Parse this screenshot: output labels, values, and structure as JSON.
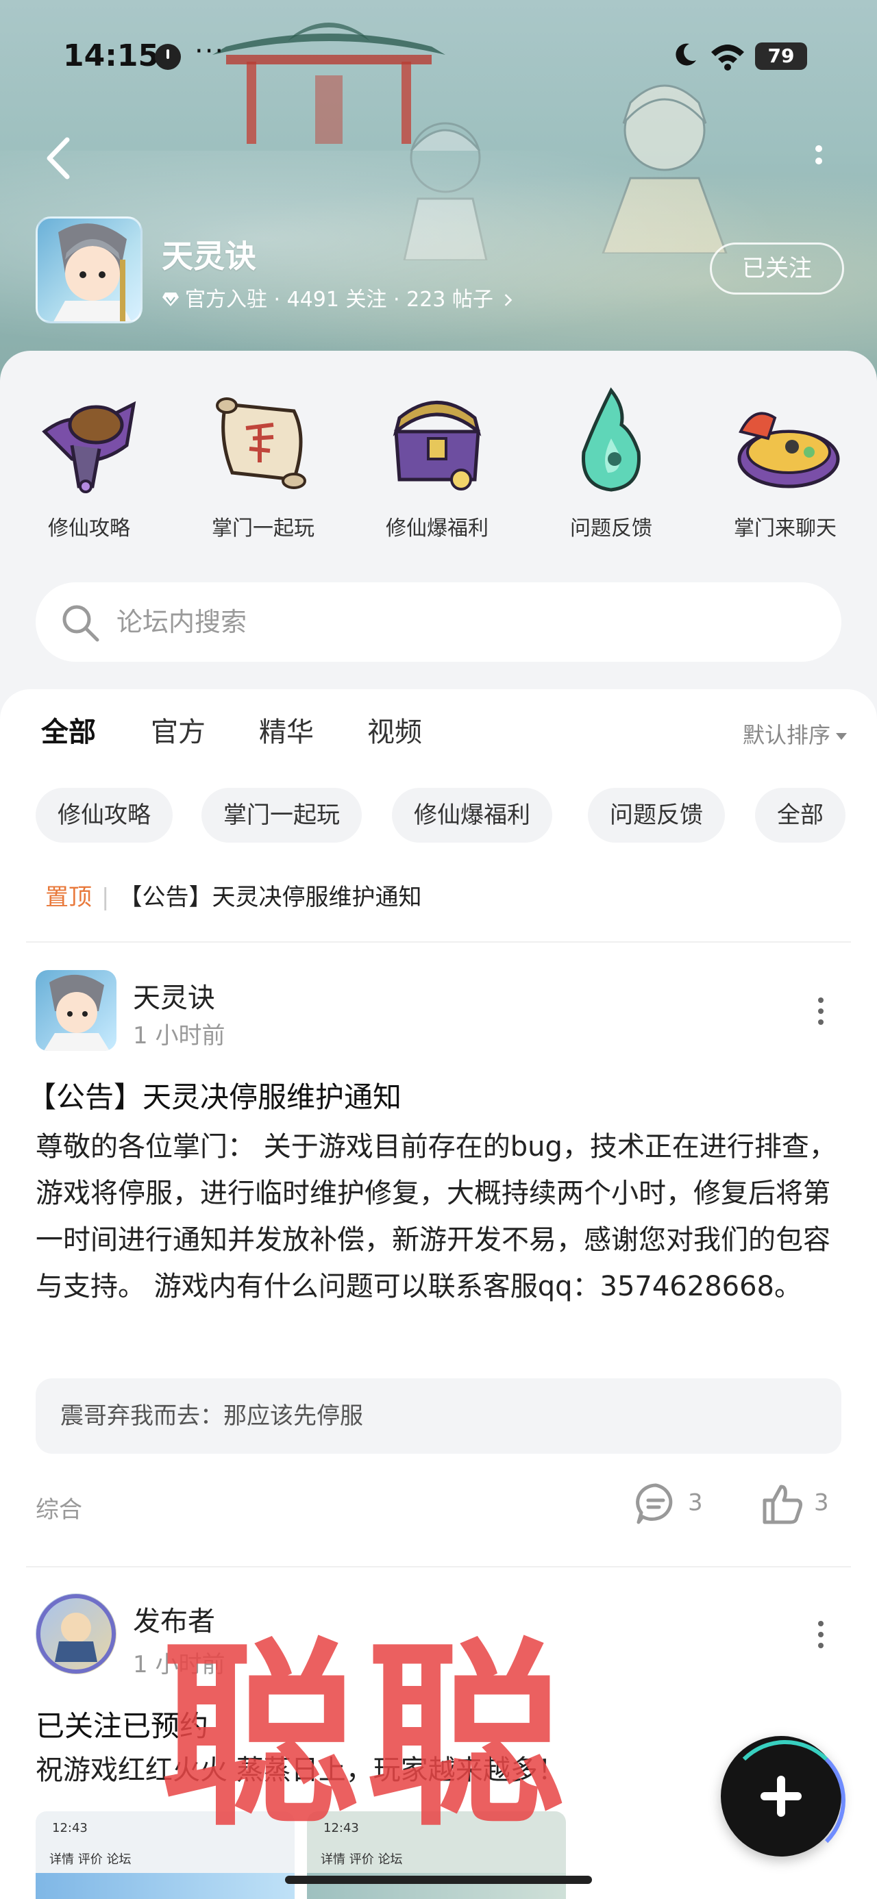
{
  "status_bar": {
    "time": "14:15",
    "more": "···",
    "battery": "79"
  },
  "forum": {
    "name": "天灵诀",
    "badge": "官方入驻",
    "followers": "4491 关注",
    "posts": "223 帖子",
    "separator": " · ",
    "follow_label": "已关注"
  },
  "categories": [
    {
      "label": "修仙攻略",
      "icon": "purple-lantern-icon"
    },
    {
      "label": "掌门一起玩",
      "icon": "battle-scroll-icon"
    },
    {
      "label": "修仙爆福利",
      "icon": "treasure-chest-icon"
    },
    {
      "label": "问题反馈",
      "icon": "jade-flame-icon"
    },
    {
      "label": "掌门来聊天",
      "icon": "food-plate-icon"
    }
  ],
  "search": {
    "placeholder": "论坛内搜索"
  },
  "tabs": [
    "全部",
    "官方",
    "精华",
    "视频"
  ],
  "active_tab": "全部",
  "sort_label": "默认排序",
  "chips": [
    "修仙攻略",
    "掌门一起玩",
    "修仙爆福利",
    "问题反馈",
    "全部"
  ],
  "pinned": {
    "tag": "置顶",
    "title": "【公告】天灵决停服维护通知"
  },
  "posts": [
    {
      "author": "天灵诀",
      "time": "1 小时前",
      "title": "【公告】天灵决停服维护通知",
      "body": "尊敬的各位掌门：  关于游戏目前存在的bug，技术正在进行排查，游戏将停服，进行临时维护修复，大概持续两个小时，修复后将第一时间进行通知并发放补偿，新游开发不易，感谢您对我们的包容与支持。 游戏内有什么问题可以联系客服qq：3574628668。",
      "top_comment": "震哥弃我而去：那应该先停服",
      "tag": "综合",
      "comments": "3",
      "likes": "3"
    },
    {
      "author": "发布者",
      "time": "1 小时前",
      "title": "已关注已预约",
      "body": "祝游戏红红火火 蒸蒸日上，玩家越来越多！",
      "thumbs": [
        {
          "time": "12:43",
          "nav": "详情   评价   论坛"
        },
        {
          "time": "12:43",
          "nav": "详情   评价   论坛"
        }
      ]
    }
  ],
  "watermark": "聪聪",
  "colors": {
    "accent": "#3ec6b6",
    "pinned": "#e8783a",
    "watermark": "#e84646"
  }
}
